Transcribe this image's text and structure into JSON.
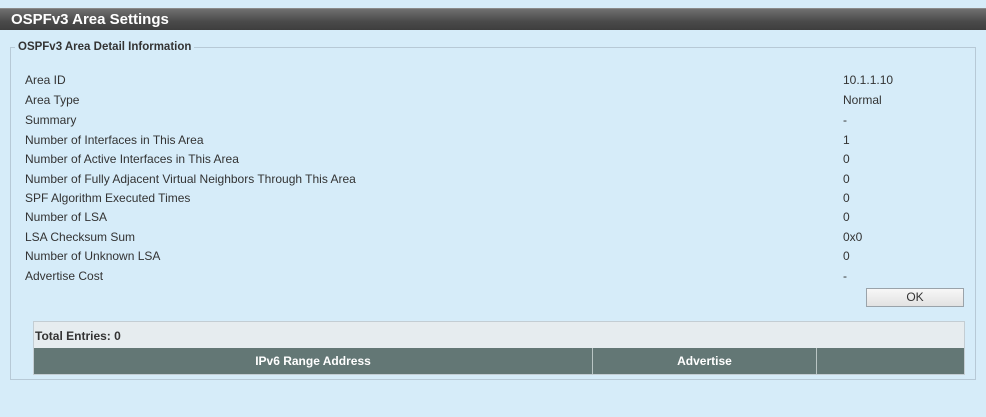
{
  "page": {
    "title": "OSPFv3 Area Settings"
  },
  "detail": {
    "legend": "OSPFv3 Area Detail Information",
    "rows": [
      {
        "label": "Area ID",
        "value": "10.1.1.10"
      },
      {
        "label": "Area Type",
        "value": "Normal"
      },
      {
        "label": "Summary",
        "value": "-"
      },
      {
        "label": "Number of Interfaces in This Area",
        "value": "1"
      },
      {
        "label": "Number of Active Interfaces in This Area",
        "value": "0"
      },
      {
        "label": "Number of Fully Adjacent Virtual Neighbors Through This Area",
        "value": "0"
      },
      {
        "label": "SPF Algorithm Executed Times",
        "value": "0"
      },
      {
        "label": "Number of LSA",
        "value": "0"
      },
      {
        "label": "LSA Checksum Sum",
        "value": "0x0"
      },
      {
        "label": "Number of Unknown LSA",
        "value": "0"
      },
      {
        "label": "Advertise Cost",
        "value": "-"
      }
    ],
    "ok_label": "OK"
  },
  "range_table": {
    "total_entries": "Total Entries: 0",
    "columns": [
      "IPv6 Range Address",
      "Advertise",
      ""
    ]
  }
}
